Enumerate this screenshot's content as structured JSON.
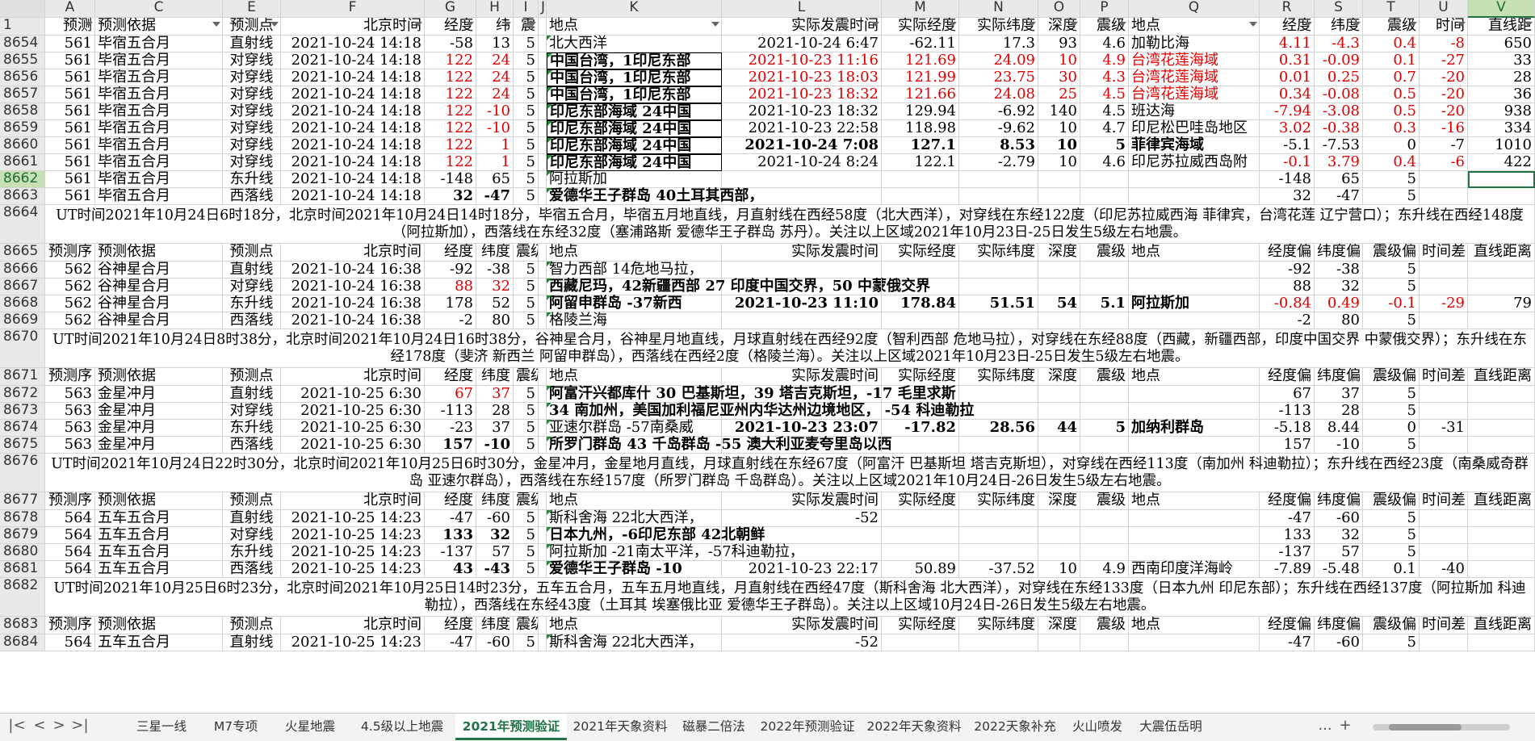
{
  "column_headers": [
    "A",
    "C",
    "E",
    "F",
    "G",
    "H",
    "I",
    "J",
    "K",
    "L",
    "M",
    "N",
    "O",
    "P",
    "Q",
    "R",
    "S",
    "T",
    "U",
    "V"
  ],
  "selected_column": "V",
  "rows": [
    {
      "num": "1",
      "type": "header",
      "cells": {
        "A": "预测",
        "C": "预测依据",
        "E": "预测点",
        "F": "北京时间",
        "G": "经度",
        "H": "纬",
        "I": "震",
        "K": "地点",
        "L": "实际发震时间",
        "M": "实际经度",
        "N": "实际纬度",
        "O": "深度",
        "P": "震级",
        "Q": "地点",
        "R": "经度",
        "S": "纬度",
        "T": "震级",
        "U": "时间",
        "V": "直线距"
      }
    },
    {
      "num": "8654",
      "cells": {
        "A": "561",
        "C": "毕宿五合月",
        "E": "直射线",
        "F": "2021-10-24 14:18",
        "G": "-58",
        "H": "13",
        "I": "5",
        "K": "北大西洋",
        "L": "2021-10-24 6:47",
        "M": "-62.11",
        "N": "17.3",
        "O": "93",
        "P": "4.6",
        "Q": "加勒比海",
        "R": "4.11",
        "S": "-4.3",
        "T": "0.4",
        "U": "-8",
        "V": "650"
      }
    },
    {
      "num": "8655",
      "cells": {
        "A": "561",
        "C": "毕宿五合月",
        "E": "对穿线",
        "F": "2021-10-24 14:18",
        "G": "122",
        "H": "24",
        "I": "5",
        "K": "中国台湾，1印尼东部",
        "L": "2021-10-23 11:16",
        "M": "121.69",
        "N": "24.09",
        "O": "10",
        "P": "4.9",
        "Q": "台湾花莲海域",
        "R": "0.31",
        "S": "-0.09",
        "T": "0.1",
        "U": "-27",
        "V": "33"
      }
    },
    {
      "num": "8656",
      "cells": {
        "A": "561",
        "C": "毕宿五合月",
        "E": "对穿线",
        "F": "2021-10-24 14:18",
        "G": "122",
        "H": "24",
        "I": "5",
        "K": "中国台湾，1印尼东部",
        "L": "2021-10-23 18:03",
        "M": "121.99",
        "N": "23.75",
        "O": "30",
        "P": "4.3",
        "Q": "台湾花莲海域",
        "R": "0.01",
        "S": "0.25",
        "T": "0.7",
        "U": "-20",
        "V": "28"
      }
    },
    {
      "num": "8657",
      "cells": {
        "A": "561",
        "C": "毕宿五合月",
        "E": "对穿线",
        "F": "2021-10-24 14:18",
        "G": "122",
        "H": "24",
        "I": "5",
        "K": "中国台湾，1印尼东部",
        "L": "2021-10-23 18:32",
        "M": "121.66",
        "N": "24.08",
        "O": "25",
        "P": "4.5",
        "Q": "台湾花莲海域",
        "R": "0.34",
        "S": "-0.08",
        "T": "0.5",
        "U": "-20",
        "V": "36"
      }
    },
    {
      "num": "8658",
      "cells": {
        "A": "561",
        "C": "毕宿五合月",
        "E": "对穿线",
        "F": "2021-10-24 14:18",
        "G": "122",
        "H": "-10",
        "I": "5",
        "K": "印尼东部海域 24中国",
        "L": "2021-10-23 18:32",
        "M": "129.94",
        "N": "-6.92",
        "O": "140",
        "P": "4.5",
        "Q": "班达海",
        "R": "-7.94",
        "S": "-3.08",
        "T": "0.5",
        "U": "-20",
        "V": "938"
      }
    },
    {
      "num": "8659",
      "cells": {
        "A": "561",
        "C": "毕宿五合月",
        "E": "对穿线",
        "F": "2021-10-24 14:18",
        "G": "122",
        "H": "-10",
        "I": "5",
        "K": "印尼东部海域 24中国",
        "L": "2021-10-23 22:58",
        "M": "118.98",
        "N": "-9.62",
        "O": "10",
        "P": "4.7",
        "Q": "印尼松巴哇岛地区",
        "R": "3.02",
        "S": "-0.38",
        "T": "0.3",
        "U": "-16",
        "V": "334"
      }
    },
    {
      "num": "8660",
      "cells": {
        "A": "561",
        "C": "毕宿五合月",
        "E": "对穿线",
        "F": "2021-10-24 14:18",
        "G": "122",
        "H": "1",
        "I": "5",
        "K": "印尼东部海域 24中国",
        "L": "2021-10-24 7:08",
        "M": "127.1",
        "N": "8.53",
        "O": "10",
        "P": "5",
        "Q": "菲律宾海域",
        "R": "-5.1",
        "S": "-7.53",
        "T": "0",
        "U": "-7",
        "V": "1010"
      }
    },
    {
      "num": "8661",
      "cells": {
        "A": "561",
        "C": "毕宿五合月",
        "E": "对穿线",
        "F": "2021-10-24 14:18",
        "G": "122",
        "H": "1",
        "I": "5",
        "K": "印尼东部海域 24中国",
        "L": "2021-10-24 8:24",
        "M": "122.1",
        "N": "-2.79",
        "O": "10",
        "P": "4.6",
        "Q": "印尼苏拉威西岛附",
        "R": "-0.1",
        "S": "3.79",
        "T": "0.4",
        "U": "-6",
        "V": "422"
      }
    },
    {
      "num": "8662",
      "cells": {
        "A": "561",
        "C": "毕宿五合月",
        "E": "东升线",
        "F": "2021-10-24 14:18",
        "G": "-148",
        "H": "65",
        "I": "5",
        "K": "阿拉斯加",
        "R": "-148",
        "S": "65",
        "T": "5"
      }
    },
    {
      "num": "8663",
      "cells": {
        "A": "561",
        "C": "毕宿五合月",
        "E": "西落线",
        "F": "2021-10-24 14:18",
        "G": "32",
        "H": "-47",
        "I": "5",
        "K": "爱德华王子群岛 40土耳其西部，",
        "R": "32",
        "S": "-47",
        "T": "5"
      }
    },
    {
      "num": "8664",
      "type": "merged",
      "text": "UT时间2021年10月24日6时18分，北京时间2021年10月24日14时18分，毕宿五合月，毕宿五月地直线，月直射线在西经58度（北大西洋），对穿线在东经122度（印尼苏拉威西海 菲律宾，台湾花莲 辽宁营口）；东升线在西经148度（阿拉斯加），西落线在东经32度（塞浦路斯 爱德华王子群岛 苏丹）。关注以上区域2021年10月23日-25日发生5级左右地震。"
    },
    {
      "num": "8665",
      "type": "header",
      "cells": {
        "A": "预测序",
        "C": "预测依据",
        "E": "预测点",
        "F": "北京时间",
        "G": "经度",
        "H": "纬度",
        "I": "震级",
        "K": "地点",
        "L": "实际发震时间",
        "M": "实际经度",
        "N": "实际纬度",
        "O": "深度",
        "P": "震级",
        "Q": "地点",
        "R": "经度偏",
        "S": "纬度偏",
        "T": "震级偏",
        "U": "时间差",
        "V": "直线距离"
      }
    },
    {
      "num": "8666",
      "cells": {
        "A": "562",
        "C": "谷神星合月",
        "E": "直射线",
        "F": "2021-10-24 16:38",
        "G": "-92",
        "H": "-38",
        "I": "5",
        "K": "智力西部 14危地马拉，",
        "R": "-92",
        "S": "-38",
        "T": "5"
      }
    },
    {
      "num": "8667",
      "cells": {
        "A": "562",
        "C": "谷神星合月",
        "E": "对穿线",
        "F": "2021-10-24 16:38",
        "G": "88",
        "H": "32",
        "I": "5",
        "K": "西藏尼玛，42新疆西部 27 印度中国交界，50 中蒙俄交界",
        "R": "88",
        "S": "32",
        "T": "5"
      }
    },
    {
      "num": "8668",
      "cells": {
        "A": "562",
        "C": "谷神星合月",
        "E": "东升线",
        "F": "2021-10-24 16:38",
        "G": "178",
        "H": "52",
        "I": "5",
        "K": "阿留申群岛 -37新西",
        "L": "2021-10-23 11:10",
        "M": "178.84",
        "N": "51.51",
        "O": "54",
        "P": "5.1",
        "Q": "阿拉斯加",
        "R": "-0.84",
        "S": "0.49",
        "T": "-0.1",
        "U": "-29",
        "V": "79"
      }
    },
    {
      "num": "8669",
      "cells": {
        "A": "562",
        "C": "谷神星合月",
        "E": "西落线",
        "F": "2021-10-24 16:38",
        "G": "-2",
        "H": "80",
        "I": "5",
        "K": "格陵兰海",
        "R": "-2",
        "S": "80",
        "T": "5"
      }
    },
    {
      "num": "8670",
      "type": "merged",
      "text": "UT时间2021年10月24日8时38分，北京时间2021年10月24日16时38分，谷神星合月，谷神星月地直线，月球直射线在西经92度（智利西部 危地马拉），对穿线在东经88度（西藏，新疆西部，印度中国交界 中蒙俄交界）；东升线在东经178度（斐济 新西兰 阿留申群岛），西落线在西经2度（格陵兰海）。关注以上区域2021年10月23日-25日发生5级左右地震。"
    },
    {
      "num": "8671",
      "type": "header",
      "cells": {
        "A": "预测序",
        "C": "预测依据",
        "E": "预测点",
        "F": "北京时间",
        "G": "经度",
        "H": "纬度",
        "I": "震级",
        "K": "地点",
        "L": "实际发震时间",
        "M": "实际经度",
        "N": "实际纬度",
        "O": "深度",
        "P": "震级",
        "Q": "地点",
        "R": "经度偏",
        "S": "纬度偏",
        "T": "震级偏",
        "U": "时间差",
        "V": "直线距离"
      }
    },
    {
      "num": "8672",
      "cells": {
        "A": "563",
        "C": "金星冲月",
        "E": "直射线",
        "F": "2021-10-25 6:30",
        "G": "67",
        "H": "37",
        "I": "5",
        "K": "阿富汗兴都库什 30 巴基斯坦，39 塔吉克斯坦，-17 毛里求斯",
        "R": "67",
        "S": "37",
        "T": "5"
      }
    },
    {
      "num": "8673",
      "cells": {
        "A": "563",
        "C": "金星冲月",
        "E": "对穿线",
        "F": "2021-10-25 6:30",
        "G": "-113",
        "H": "28",
        "I": "5",
        "K": "34 南加州，美国加利福尼亚州内华达州边境地区， -54 科迪勒拉",
        "R": "-113",
        "S": "28",
        "T": "5"
      }
    },
    {
      "num": "8674",
      "cells": {
        "A": "563",
        "C": "金星冲月",
        "E": "东升线",
        "F": "2021-10-25 6:30",
        "G": "-23",
        "H": "37",
        "I": "5",
        "K": "亚速尔群岛 -57南桑威",
        "L": "2021-10-23 23:07",
        "M": "-17.82",
        "N": "28.56",
        "O": "44",
        "P": "5",
        "Q": "加纳利群岛",
        "R": "-5.18",
        "S": "8.44",
        "T": "0",
        "U": "-31"
      }
    },
    {
      "num": "8675",
      "cells": {
        "A": "563",
        "C": "金星冲月",
        "E": "西落线",
        "F": "2021-10-25 6:30",
        "G": "157",
        "H": "-10",
        "I": "5",
        "K": "所罗门群岛 43 千岛群岛 -55 澳大利亚麦夸里岛以西",
        "R": "157",
        "S": "-10",
        "T": "5"
      }
    },
    {
      "num": "8676",
      "type": "merged",
      "text": "UT时间2021年10月24日22时30分，北京时间2021年10月25日6时30分，金星冲月，金星地月直线，月球直射线在东经67度（阿富汗 巴基斯坦 塔吉克斯坦），对穿线在西经113度（南加州 科迪勒拉）；东升线在西经23度（南桑威奇群岛 亚速尔群岛），西落线在东经157度（所罗门群岛 千岛群岛）。关注以上区域2021年10月24日-26日发生5级左右地震。"
    },
    {
      "num": "8677",
      "type": "header",
      "cells": {
        "A": "预测序",
        "C": "预测依据",
        "E": "预测点",
        "F": "北京时间",
        "G": "经度",
        "H": "纬度",
        "I": "震级",
        "K": "地点",
        "L": "实际发震时间",
        "M": "实际经度",
        "N": "实际纬度",
        "O": "深度",
        "P": "震级",
        "Q": "地点",
        "R": "经度偏",
        "S": "纬度偏",
        "T": "震级偏",
        "U": "时间差",
        "V": "直线距离"
      }
    },
    {
      "num": "8678",
      "cells": {
        "A": "564",
        "C": "五车五合月",
        "E": "直射线",
        "F": "2021-10-25 14:23",
        "G": "-47",
        "H": "-60",
        "I": "5",
        "K": "斯科舍海 22北大西洋，",
        "L": "-52",
        "R": "-47",
        "S": "-60",
        "T": "5"
      }
    },
    {
      "num": "8679",
      "cells": {
        "A": "564",
        "C": "五车五合月",
        "E": "对穿线",
        "F": "2021-10-25 14:23",
        "G": "133",
        "H": "32",
        "I": "5",
        "K": "日本九州，-6印尼东部 42北朝鲜",
        "R": "133",
        "S": "32",
        "T": "5"
      }
    },
    {
      "num": "8680",
      "cells": {
        "A": "564",
        "C": "五车五合月",
        "E": "东升线",
        "F": "2021-10-25 14:23",
        "G": "-137",
        "H": "57",
        "I": "5",
        "K": "阿拉斯加 -21南太平洋，-57科迪勒拉，",
        "R": "-137",
        "S": "57",
        "T": "5"
      }
    },
    {
      "num": "8681",
      "cells": {
        "A": "564",
        "C": "五车五合月",
        "E": "西落线",
        "F": "2021-10-25 14:23",
        "G": "43",
        "H": "-43",
        "I": "5",
        "K": "爱德华王子群岛 -10",
        "L": "2021-10-23 22:17",
        "M": "50.89",
        "N": "-37.52",
        "O": "10",
        "P": "4.9",
        "Q": "西南印度洋海岭",
        "R": "-7.89",
        "S": "-5.48",
        "T": "0.1",
        "U": "-40"
      }
    },
    {
      "num": "8682",
      "type": "merged",
      "text": "UT时间2021年10月25日6时23分，北京时间2021年10月25日14时23分，五车五合月，五车五月地直线，月直射线在西经47度（斯科舍海 北大西洋），对穿线在东经133度（日本九州 印尼东部）；东升线在西经137度（阿拉斯加 科迪勒拉），西落线在东经43度（土耳其 埃塞俄比亚 爱德华王子群岛）。关注以上区域10月24日-26日发生5级左右地震。"
    },
    {
      "num": "8683",
      "type": "header",
      "cells": {
        "A": "预测序",
        "C": "预测依据",
        "E": "预测点",
        "F": "北京时间",
        "G": "经度",
        "H": "纬度",
        "I": "震级",
        "K": "地点",
        "L": "实际发震时间",
        "M": "实际经度",
        "N": "实际纬度",
        "O": "深度",
        "P": "震级",
        "Q": "地点",
        "R": "经度偏",
        "S": "纬度偏",
        "T": "震级偏",
        "U": "时间差",
        "V": "直线距离"
      }
    },
    {
      "num": "8684",
      "cells": {
        "A": "564",
        "C": "五车五合月",
        "E": "直射线",
        "F": "2021-10-25 14:23",
        "G": "-47",
        "H": "-60",
        "I": "5",
        "K": "斯科舍海 22北大西洋，",
        "L": "-52",
        "R": "-47",
        "S": "-60",
        "T": "5"
      }
    }
  ],
  "selected_row": "8662",
  "sheet_tabs": [
    "三星一线",
    "M7专项",
    "火星地震",
    "4.5级以上地震",
    "2021年预测验证",
    "2021年天象资料",
    "磁暴二倍法",
    "2022年预测验证",
    "2022年天象资料",
    "2022天象补充",
    "火山喷发",
    "大震伍岳明"
  ],
  "active_tab": "2021年预测验证",
  "tab_nav_icons": [
    "first-sheet-icon",
    "prev-sheet-icon",
    "next-sheet-icon",
    "last-sheet-icon"
  ],
  "tab_nav_glyphs": [
    "|<",
    "<",
    ">",
    ">|"
  ],
  "more_tabs_glyph": "...",
  "add_sheet_glyph": "+",
  "colors": {
    "accent": "#217346",
    "red_text": "#e00000",
    "header_bg": "#e9e9e9",
    "selected_header_bg": "#c6e0b4"
  }
}
